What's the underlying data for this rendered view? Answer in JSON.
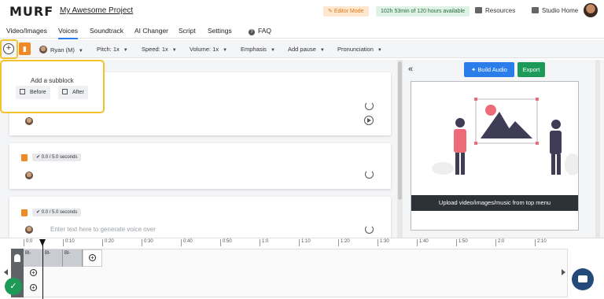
{
  "header": {
    "logo": "MURF",
    "project_title": "My Awesome Project",
    "mode_badge": "Editor Mode",
    "hours_badge": "102h 53min of 120 hours available",
    "resources": "Resources",
    "studio_home": "Studio Home"
  },
  "tabs": [
    "Video/Images",
    "Voices",
    "Soundtrack",
    "AI Changer",
    "Script",
    "Settings",
    "FAQ"
  ],
  "active_tab": "Voices",
  "toolbar": {
    "voice": "Ryan (M)",
    "pitch": "Pitch: 1x",
    "speed": "Speed: 1x",
    "volume": "Volume: 1x",
    "emphasis": "Emphasis",
    "add_pause": "Add pause",
    "pronunciation": "Pronunciation"
  },
  "popover": {
    "title": "Add a subblock",
    "before": "Before",
    "after": "After"
  },
  "blocks": [
    {
      "duration": ""
    },
    {
      "duration": "0.0 / 5.0 seconds"
    },
    {
      "duration": "0.0 / 5.0 seconds",
      "placeholder": "Enter text here to generate voice over"
    }
  ],
  "right_panel": {
    "build_audio": "Build Audio",
    "export": "Export",
    "preview_caption": "Upload video/images/music from top menu"
  },
  "timeline": {
    "ticks": [
      "0:0",
      "0:10",
      "0:20",
      "0:30",
      "0:40",
      "0:50",
      "1:0",
      "1:10",
      "1:20",
      "1:30",
      "1:40",
      "1:50",
      "2:0",
      "2:10"
    ],
    "clip_labels": [
      "Bl-",
      "Bl-",
      "Bl-"
    ]
  },
  "colors": {
    "accent_blue": "#2b7de9",
    "export_green": "#1d9a58",
    "orange": "#f08a24",
    "highlight_yellow": "#f2c12e"
  }
}
